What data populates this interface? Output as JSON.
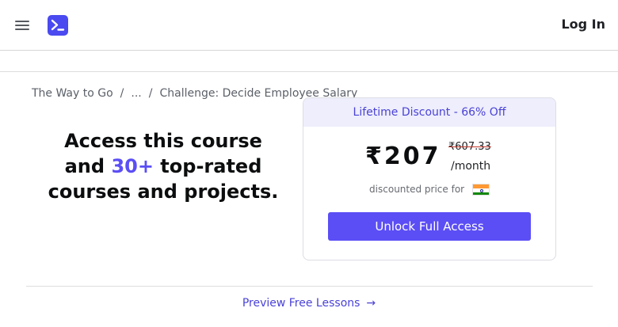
{
  "header": {
    "menu_icon": "hamburger-menu-icon",
    "logo_icon": "terminal-prompt-icon",
    "login_label": "Log In",
    "brand_color": "#4a4af0"
  },
  "breadcrumb": {
    "items": [
      "The Way to Go",
      "...",
      "Challenge: Decide Employee Salary"
    ],
    "separator": "/"
  },
  "promo": {
    "headline_part1": "Access this course and ",
    "headline_accent": "30+",
    "headline_part2": " top-rated courses and projects.",
    "accent_color": "#5b4ef5"
  },
  "pricing": {
    "banner": "Lifetime Discount - 66% Off",
    "price": "₹207",
    "original_price": "₹607.33",
    "period": "/month",
    "discount_note": "discounted price for",
    "flag_icon": "india-flag-icon",
    "cta_label": "Unlock Full Access",
    "cta_color": "#5b4ef5"
  },
  "footer": {
    "preview_label": "Preview Free Lessons",
    "preview_arrow": "→"
  }
}
